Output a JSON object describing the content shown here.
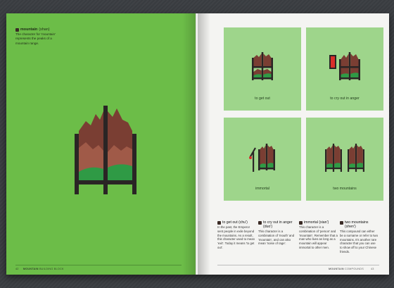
{
  "left_page": {
    "title": "mountain",
    "pinyin": "(shan)",
    "body": "The character for 'mountain' represents the peaks of a mountain range.",
    "page_number": "42",
    "footer_section": "MOUNTAIN",
    "footer_label": "BUILDING BLOCK"
  },
  "right_page": {
    "cards": [
      {
        "caption": "to get out"
      },
      {
        "caption": "to cry out in anger"
      },
      {
        "caption": "immortal"
      },
      {
        "caption": "two mountains"
      }
    ],
    "descriptions": [
      {
        "title": "to get out (chu')",
        "body": "In the past, the Emperor sent people in exile beyond the mountains. As a result, this character used to mean 'exit'. Today it means 'to get out'."
      },
      {
        "title": "to cry out in anger (duo')",
        "body": "This character is a combination of 'mouth' and 'mountain', and can also mean 'noise of rage'."
      },
      {
        "title": "immortal (xian')",
        "body": "This character is a combination of 'person' and 'mountain'. Remember that a man who lives as long as a mountain will appear immortal to other men."
      },
      {
        "title": "two mountains (shen')",
        "body": "This compound can either be a surname or refer to two mountains. It's another rare character that you can use to show off to your Chinese friends."
      }
    ],
    "footer_section": "MOUNTAIN",
    "footer_label": "COMPOUNDS",
    "page_number": "43"
  },
  "colors": {
    "left_page_bg": "#6cbd48",
    "card_bg": "#9ed58b",
    "mountain_dark": "#7a3e33",
    "mountain_light": "#b07060",
    "frame": "#2a2525",
    "grass": "#2f9a45",
    "accent_red": "#d9302a"
  }
}
